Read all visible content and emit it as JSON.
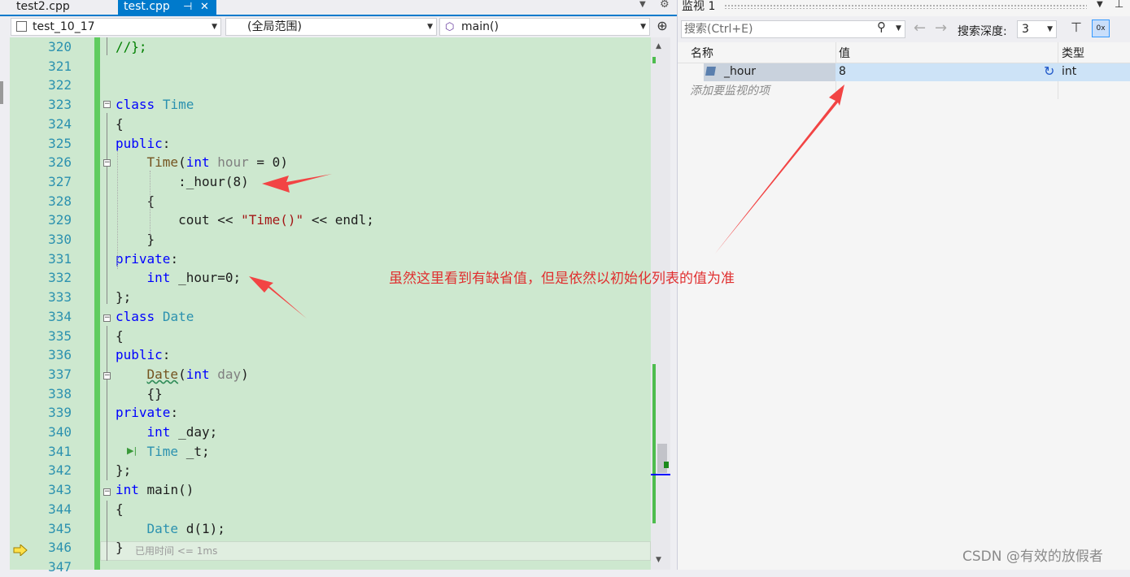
{
  "tabs": [
    {
      "name": "test2.cpp",
      "active": false
    },
    {
      "name": "test.cpp",
      "active": true,
      "pin_glyph": "⊣",
      "close_glyph": "✕"
    }
  ],
  "navbar": {
    "project": "test_10_17",
    "scope": "(全局范围)",
    "function": "main()"
  },
  "code_lines": [
    {
      "n": "320",
      "html": "<span class=\"cm\">//};</span>"
    },
    {
      "n": "321",
      "html": ""
    },
    {
      "n": "322",
      "html": ""
    },
    {
      "n": "323",
      "html": "<span class=\"kw\">class</span> <span class=\"ty\">Time</span>"
    },
    {
      "n": "324",
      "html": "{"
    },
    {
      "n": "325",
      "html": "<span class=\"kw\">public</span>:"
    },
    {
      "n": "326",
      "html": "    <span class=\"fn\">Time</span>(<span class=\"kw\">int</span> <span class=\"pm\">hour</span> = 0)"
    },
    {
      "n": "327",
      "html": "        :_hour(8)"
    },
    {
      "n": "328",
      "html": "    {"
    },
    {
      "n": "329",
      "html": "        cout &lt;&lt; <span class=\"st\">\"Time()\"</span> &lt;&lt; endl;"
    },
    {
      "n": "330",
      "html": "    }"
    },
    {
      "n": "331",
      "html": "<span class=\"kw\">private</span>:"
    },
    {
      "n": "332",
      "html": "    <span class=\"kw\">int</span> _hour=0;"
    },
    {
      "n": "333",
      "html": "};"
    },
    {
      "n": "334",
      "html": "<span class=\"kw\">class</span> <span class=\"ty\">Date</span>"
    },
    {
      "n": "335",
      "html": "{"
    },
    {
      "n": "336",
      "html": "<span class=\"kw\">public</span>:"
    },
    {
      "n": "337",
      "html": "    <span class=\"fn squig\">Date</span>(<span class=\"kw\">int</span> <span class=\"pm\">day</span>)"
    },
    {
      "n": "338",
      "html": "    {}"
    },
    {
      "n": "339",
      "html": "<span class=\"kw\">private</span>:"
    },
    {
      "n": "340",
      "html": "    <span class=\"kw\">int</span> _day;"
    },
    {
      "n": "341",
      "html": "    <span class=\"ty\">Time</span> _t;"
    },
    {
      "n": "342",
      "html": "};"
    },
    {
      "n": "343",
      "html": "<span class=\"kw\">int</span> main()"
    },
    {
      "n": "344",
      "html": "{"
    },
    {
      "n": "345",
      "html": "    <span class=\"ty\">Date</span> d(1);"
    },
    {
      "n": "346",
      "html": "}"
    },
    {
      "n": "347",
      "html": ""
    }
  ],
  "perf_tip": "已用时间 <= 1ms",
  "watch": {
    "title": "监视 1",
    "search_placeholder": "搜索(Ctrl+E)",
    "depth_label": "搜索深度:",
    "depth_value": "3",
    "hex_label": "0x",
    "columns": {
      "name": "名称",
      "value": "值",
      "type": "类型"
    },
    "rows": [
      {
        "name": "_hour",
        "value": "8",
        "type": "int"
      }
    ],
    "add_item": "添加要监视的项"
  },
  "annotation": "虽然这里看到有缺省值，但是依然以初始化列表的值为准",
  "watermark": "CSDN @有效的放假者",
  "colors": {
    "accent": "#007acc",
    "annotation": "#e03030",
    "editor_bg": "#cde8cf",
    "change_bar": "#5fcc5f"
  }
}
